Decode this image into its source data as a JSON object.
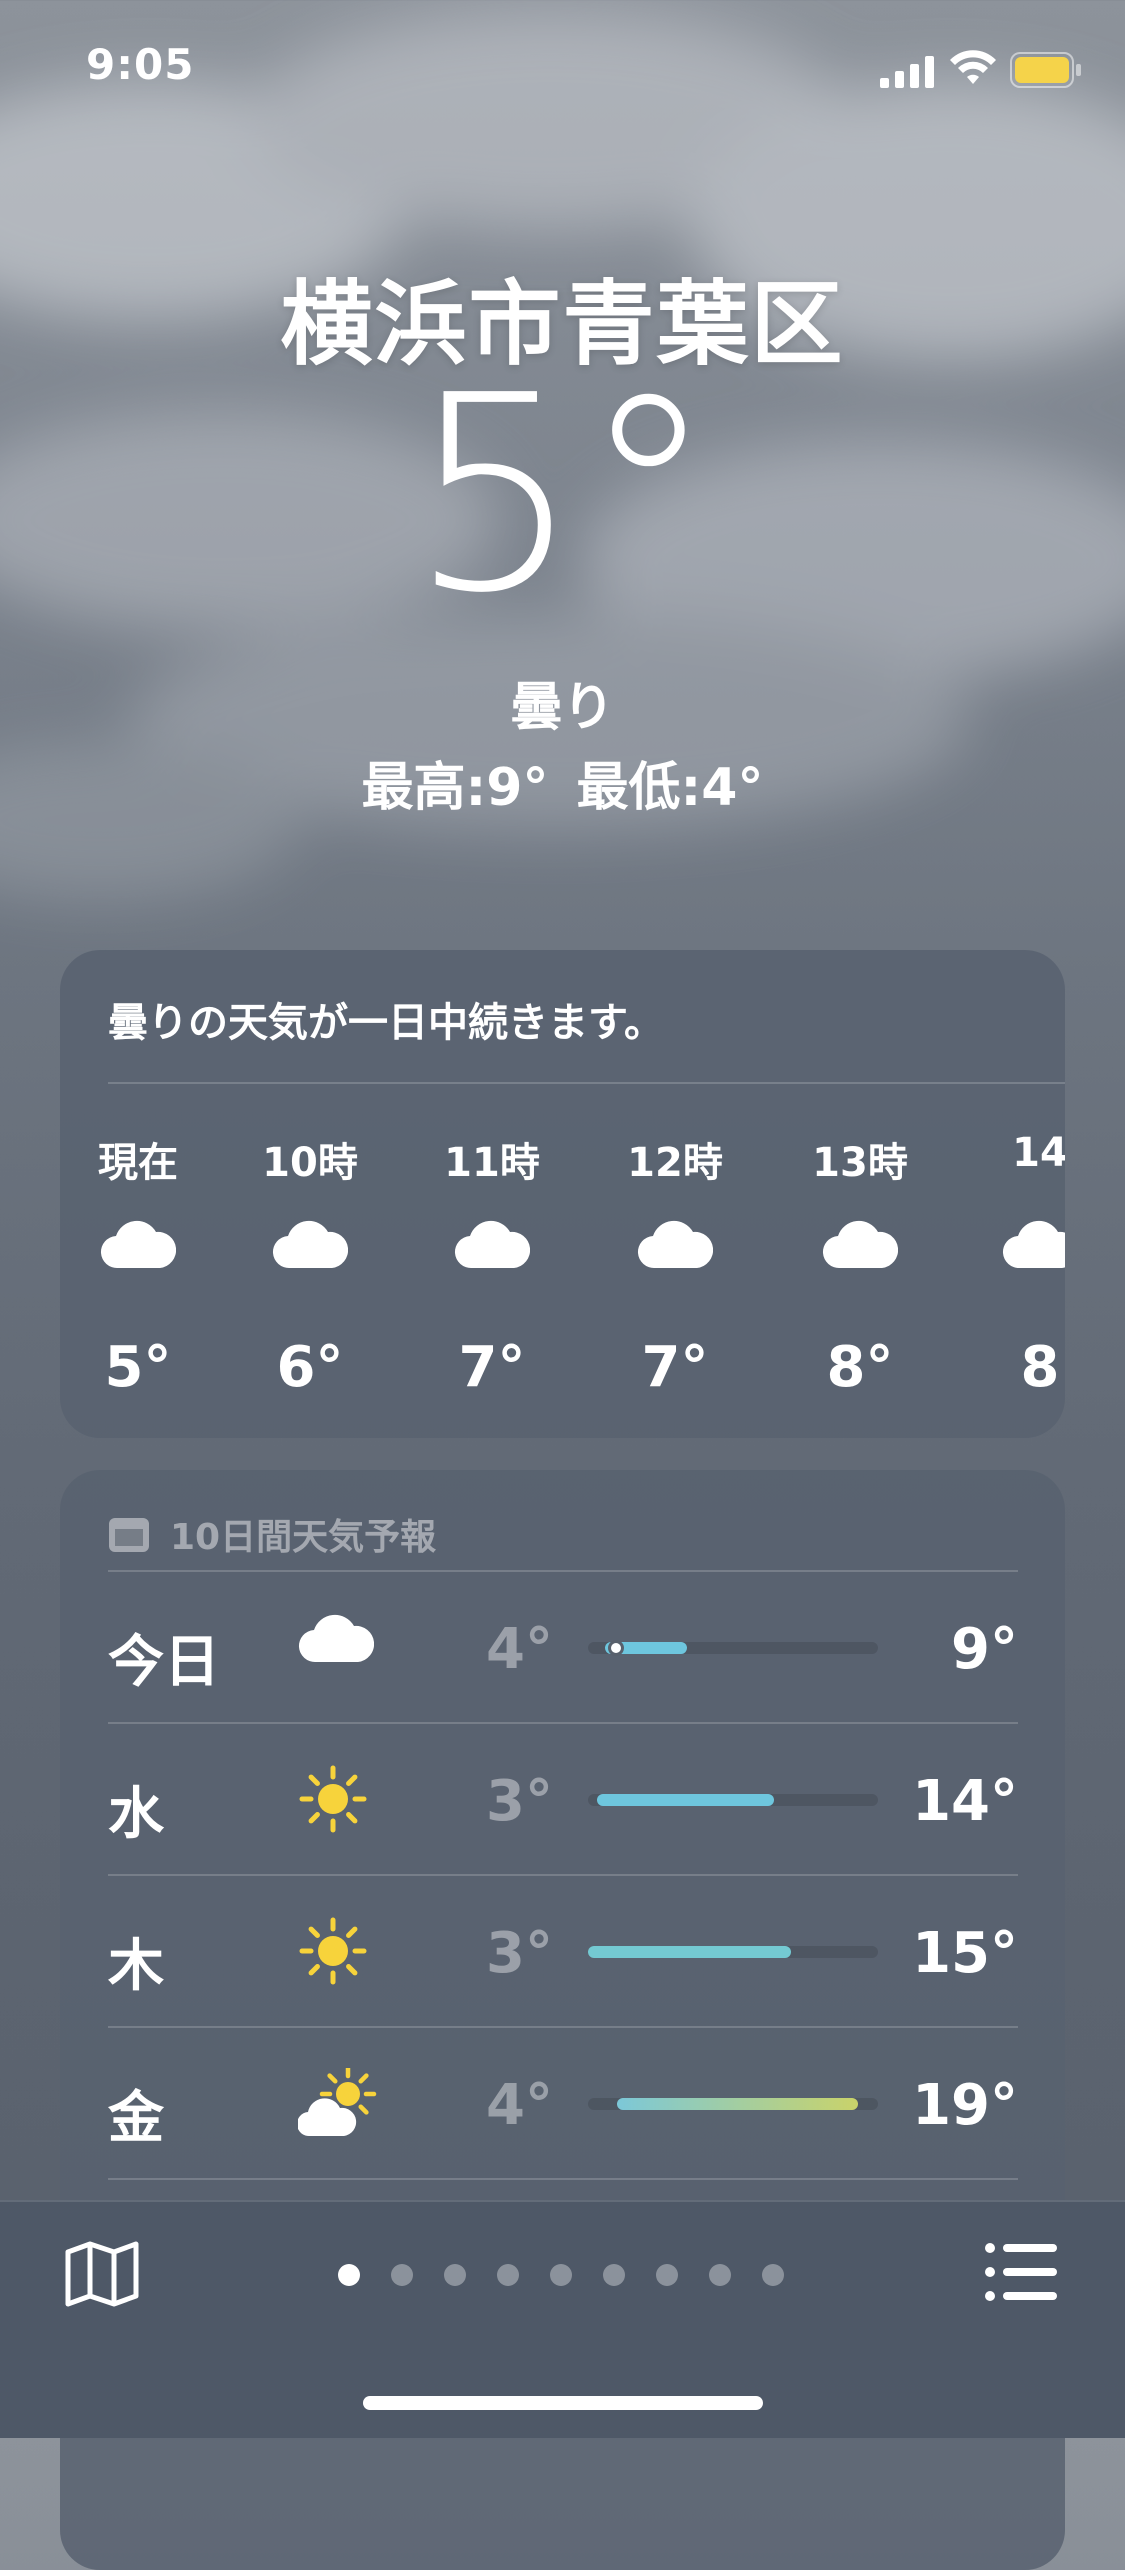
{
  "status": {
    "time": "9:05",
    "battery_color": "#f5d34a"
  },
  "location": {
    "city": "横浜市青葉区",
    "temp": "5°",
    "condition": "曇り",
    "high": "最高:9°",
    "low": "最低:4°"
  },
  "hourly": {
    "summary": "曇りの天気が一日中続きます。",
    "hours": [
      {
        "label": "現在",
        "icon": "cloud-icon",
        "temp": "5°"
      },
      {
        "label": "10時",
        "icon": "cloud-icon",
        "temp": "6°"
      },
      {
        "label": "11時",
        "icon": "cloud-icon",
        "temp": "7°"
      },
      {
        "label": "12時",
        "icon": "cloud-icon",
        "temp": "7°"
      },
      {
        "label": "13時",
        "icon": "cloud-icon",
        "temp": "8°"
      },
      {
        "label": "14",
        "icon": "cloud-icon",
        "temp": "8"
      }
    ]
  },
  "daily": {
    "header": "10日間天気予報",
    "days": [
      {
        "name": "今日",
        "icon": "cloud-icon",
        "low": "4°",
        "high": "9°",
        "bar_start": 0.06,
        "bar_end": 0.34,
        "now": 0.07,
        "bar_color": "#6ec6de"
      },
      {
        "name": "水",
        "icon": "sun-icon",
        "low": "3°",
        "high": "14°",
        "bar_start": 0.03,
        "bar_end": 0.64,
        "bar_color": "#6ec6de"
      },
      {
        "name": "木",
        "icon": "sun-icon",
        "low": "3°",
        "high": "15°",
        "bar_start": 0.0,
        "bar_end": 0.7,
        "bar_color": "#74c9d2"
      },
      {
        "name": "金",
        "icon": "partly-sunny-icon",
        "low": "4°",
        "high": "19°",
        "bar_start": 0.1,
        "bar_end": 0.93,
        "bar_color": "#7cc8d8",
        "bar_color_end": "#c9d36a"
      }
    ]
  },
  "bottom": {
    "pages": 9,
    "active_page": 0
  }
}
